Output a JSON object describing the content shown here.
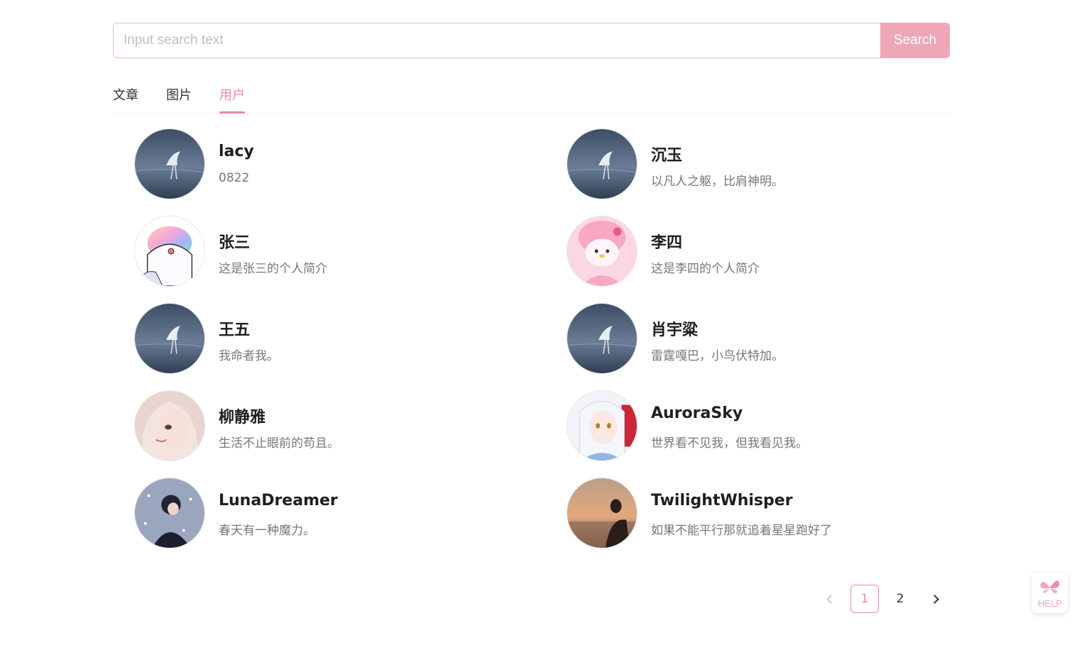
{
  "search": {
    "placeholder": "Input search text",
    "value": "",
    "button_label": "Search"
  },
  "tabs": [
    {
      "label": "文章",
      "active": false
    },
    {
      "label": "图片",
      "active": false
    },
    {
      "label": "用户",
      "active": true
    }
  ],
  "users": [
    {
      "name": "lacy",
      "bio": "0822",
      "avatar": "crane-lake-avatar"
    },
    {
      "name": "沉玉",
      "bio": "以凡人之躯，比肩神明。",
      "avatar": "crane-lake-avatar"
    },
    {
      "name": "张三",
      "bio": "这是张三的个人简介",
      "avatar": "cartoon-ghost-avatar"
    },
    {
      "name": "李四",
      "bio": "这是李四的个人简介",
      "avatar": "pink-bunny-avatar"
    },
    {
      "name": "王五",
      "bio": "我命者我。",
      "avatar": "crane-lake-avatar"
    },
    {
      "name": "肖宇粱",
      "bio": "雷霆嘎巴，小鸟伏特加。",
      "avatar": "crane-lake-avatar"
    },
    {
      "name": "柳静雅",
      "bio": "生活不止眼前的苟且。",
      "avatar": "portrait-girl-avatar"
    },
    {
      "name": "AuroraSky",
      "bio": "世界看不见我，但我看见我。",
      "avatar": "anime-girl-avatar"
    },
    {
      "name": "LunaDreamer",
      "bio": "春天有一种魔力。",
      "avatar": "snow-person-avatar"
    },
    {
      "name": "TwilightWhisper",
      "bio": "如果不能平行那就追着星星跑好了",
      "avatar": "sunset-silhouette-avatar"
    }
  ],
  "pagination": {
    "pages": [
      "1",
      "2"
    ],
    "current": "1"
  },
  "help": {
    "label": "HELP",
    "icon": "butterfly-icon"
  },
  "colors": {
    "accent": "#e78aa3",
    "button": "#efa7b8",
    "input_border": "#f2b8c6"
  }
}
